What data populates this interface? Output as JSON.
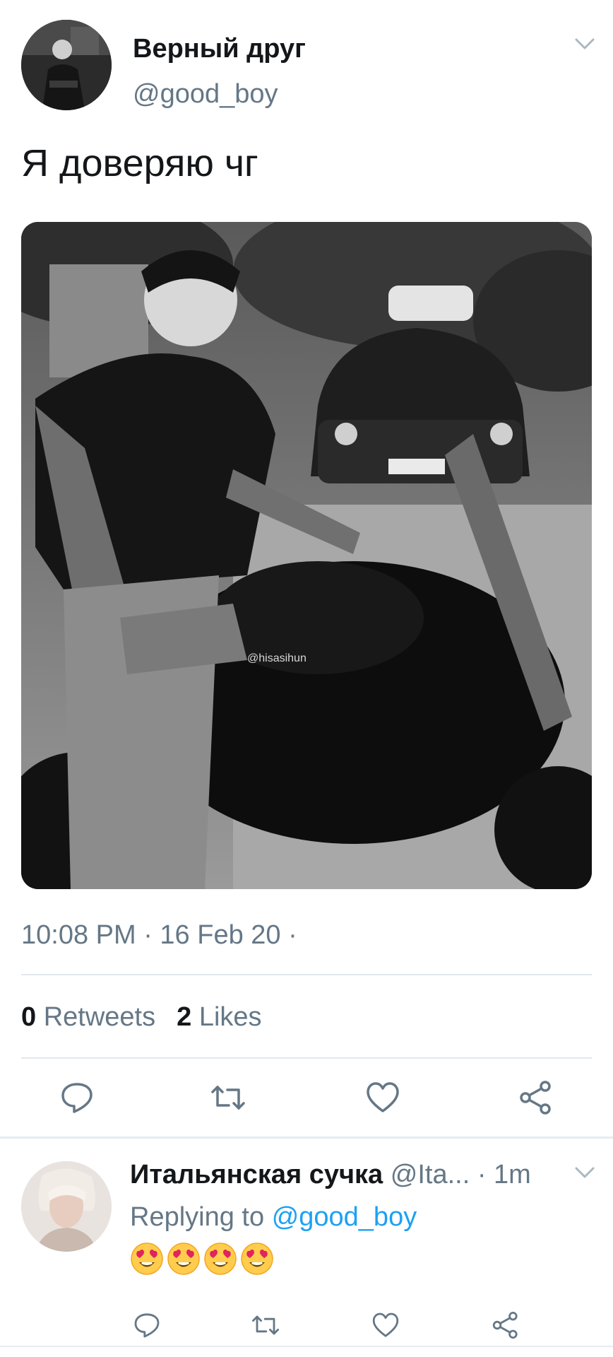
{
  "tweet": {
    "display_name": "Верный друг",
    "handle": "@good_boy",
    "text": "Я доверяю чг",
    "photo_watermark": "@hisasihun",
    "timestamp": "10:08 PM · 16 Feb 20 ·",
    "retweets_count": "0",
    "retweets_label": "Retweets",
    "likes_count": "2",
    "likes_label": "Likes"
  },
  "reply": {
    "display_name": "Итальянская сучка",
    "handle": "@Ita...",
    "time": "· 1m",
    "replying_to_label": "Replying to",
    "replying_to_handle": "@good_boy",
    "emoji_count": 4,
    "emoji_name": "heart-eyes-emoji"
  },
  "icons": {
    "actions": [
      "reply-icon",
      "retweet-icon",
      "like-icon",
      "share-icon"
    ],
    "menu": "chevron-down-icon"
  },
  "colors": {
    "text_primary": "#14171a",
    "text_secondary": "#657786",
    "link": "#1da1f2",
    "divider": "#e1e8ed"
  }
}
